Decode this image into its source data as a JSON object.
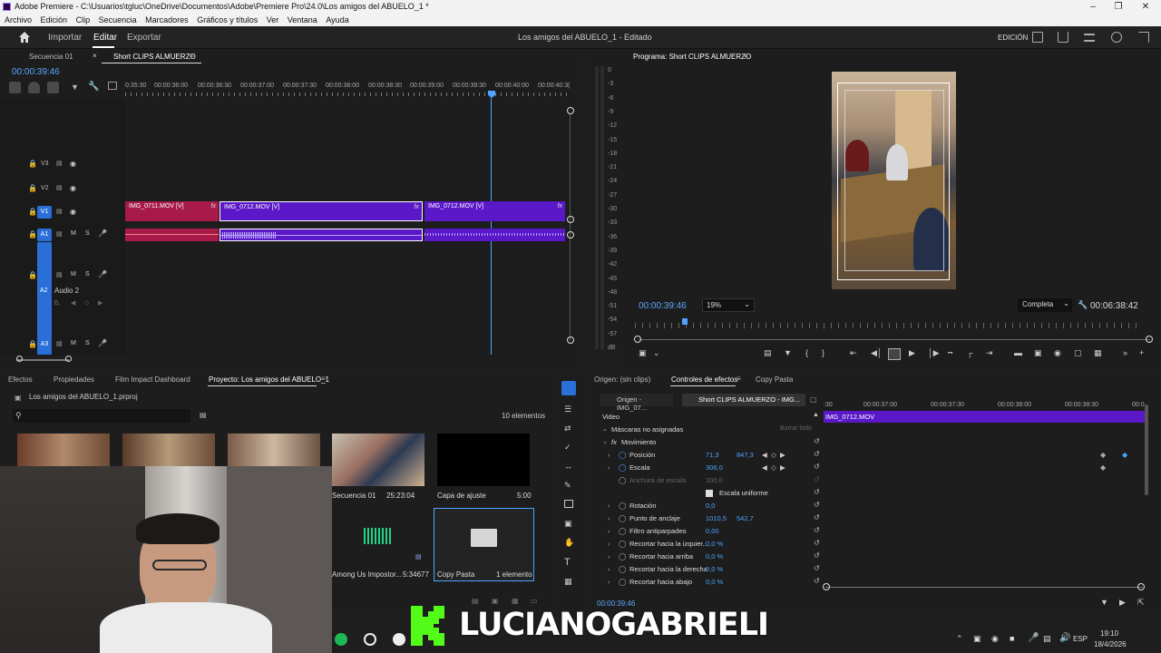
{
  "window": {
    "title": "Adobe Premiere - C:\\Usuarios\\tgluc\\OneDrive\\Documentos\\Adobe\\Premiere Pro\\24.0\\Los amigos del ABUELO_1 *"
  },
  "menu": [
    "Archivo",
    "Edición",
    "Clip",
    "Secuencia",
    "Marcadores",
    "Gráficos y títulos",
    "Ver",
    "Ventana",
    "Ayuda"
  ],
  "header": {
    "nav": [
      "Importar",
      "Editar",
      "Exportar"
    ],
    "active": "Editar",
    "document": "Los amigos del ABUELO_1 - Editado",
    "workspace": "EDICIÓN"
  },
  "timeline": {
    "tabs": [
      "Secuencia 01",
      "Short CLIPS ALMUERZO"
    ],
    "timecode": "00:00:39:46",
    "ruler": [
      "0:35:30",
      "00:00:36:00",
      "00:00:36:30",
      "00:00:37:00",
      "00:00:37:30",
      "00:00:38:00",
      "00:00:38:30",
      "00:00:39:00",
      "00:00:39:30",
      "00:00:40:00",
      "00:00:40:3("
    ],
    "tracks": {
      "v3": "V3",
      "v2": "V2",
      "v1": "V1",
      "a1": "A1",
      "a2": "A2",
      "a3": "A3",
      "a2_name": "Audio 2",
      "a2_level": "0,",
      "m": "M",
      "s": "S"
    },
    "clips": [
      {
        "label": "IMG_0711.MOV [V]",
        "color": "#a81a4a",
        "selected": false
      },
      {
        "label": "IMG_0712.MOV [V]",
        "color": "#5a18c8",
        "selected": true
      },
      {
        "label": "IMG_0712.MOV [V]",
        "color": "#5a18c8",
        "selected": false
      }
    ],
    "fx": "fx"
  },
  "meter": {
    "scale": [
      "0",
      "-3",
      "-6",
      "-9",
      "-12",
      "-15",
      "-18",
      "-21",
      "-24",
      "-27",
      "-30",
      "-33",
      "-36",
      "-39",
      "-42",
      "-45",
      "-48",
      "-51",
      "-54",
      "-57",
      "dB"
    ]
  },
  "program": {
    "title": "Programa: Short CLIPS ALMUERZO",
    "timecode": "00:00:39:46",
    "zoom": "19%",
    "quality": "Completa",
    "duration": "00:06:38:42"
  },
  "project": {
    "tabs": [
      "Efectos",
      "Propiedades",
      "Film Impact Dashboard",
      "Proyecto: Los amigos del ABUELO_1"
    ],
    "file": "Los amigos del ABUELO_1.prproj",
    "count": "10 elementos",
    "items": [
      {
        "name": "Secuencia 01",
        "duration": "25:23:04"
      },
      {
        "name": "Capa de ajuste",
        "duration": "5:00"
      },
      {
        "name": "Among Us Impostor...",
        "duration": "5:34677"
      },
      {
        "name": "Copy Pasta",
        "duration": "1 elemento"
      }
    ]
  },
  "effects": {
    "tabs": [
      "Origen: (sin clips)",
      "Controles de efectos",
      "Copy Pasta"
    ],
    "subtabs": [
      "Origen - IMG_07...",
      "Short CLIPS ALMUERZO - IMG..."
    ],
    "section": "Video",
    "masks": "Máscaras no asignadas",
    "clear": "Borrar todo",
    "motion": "Movimiento",
    "rows": [
      {
        "label": "Posición",
        "v1": "71,3",
        "v2": "847,3"
      },
      {
        "label": "Escala",
        "v1": "306,0",
        "v2": ""
      },
      {
        "label": "Anchura de escala",
        "v1": "100,0",
        "v2": ""
      },
      {
        "label": "Escala uniforme",
        "v1": "",
        "v2": ""
      },
      {
        "label": "Rotación",
        "v1": "0,0",
        "v2": ""
      },
      {
        "label": "Punto de anclaje",
        "v1": "1010,5",
        "v2": "542,7"
      },
      {
        "label": "Filtro antiparpadeo",
        "v1": "0,00",
        "v2": ""
      },
      {
        "label": "Recortar hacia la izquier...",
        "v1": "0,0 %",
        "v2": ""
      },
      {
        "label": "Recortar hacia arriba",
        "v1": "0,0 %",
        "v2": ""
      },
      {
        "label": "Recortar hacia la derecha",
        "v1": "0,0 %",
        "v2": ""
      },
      {
        "label": "Recortar hacia abajo",
        "v1": "0,0 %",
        "v2": ""
      }
    ],
    "ruler": [
      ":30",
      "00:00:37:00",
      "00:00:37:30",
      "00:00:38:00",
      "00:00:38:30",
      "00:0"
    ],
    "clip": "IMG_0712.MOV",
    "timecode": "00:00:39:46"
  },
  "brand": {
    "name": "LUCIANOGABRIELI",
    "logo_color": "#53fc18"
  },
  "taskbar": {
    "lang": "ESP",
    "time": "19:10",
    "date": "18/4/2026"
  }
}
